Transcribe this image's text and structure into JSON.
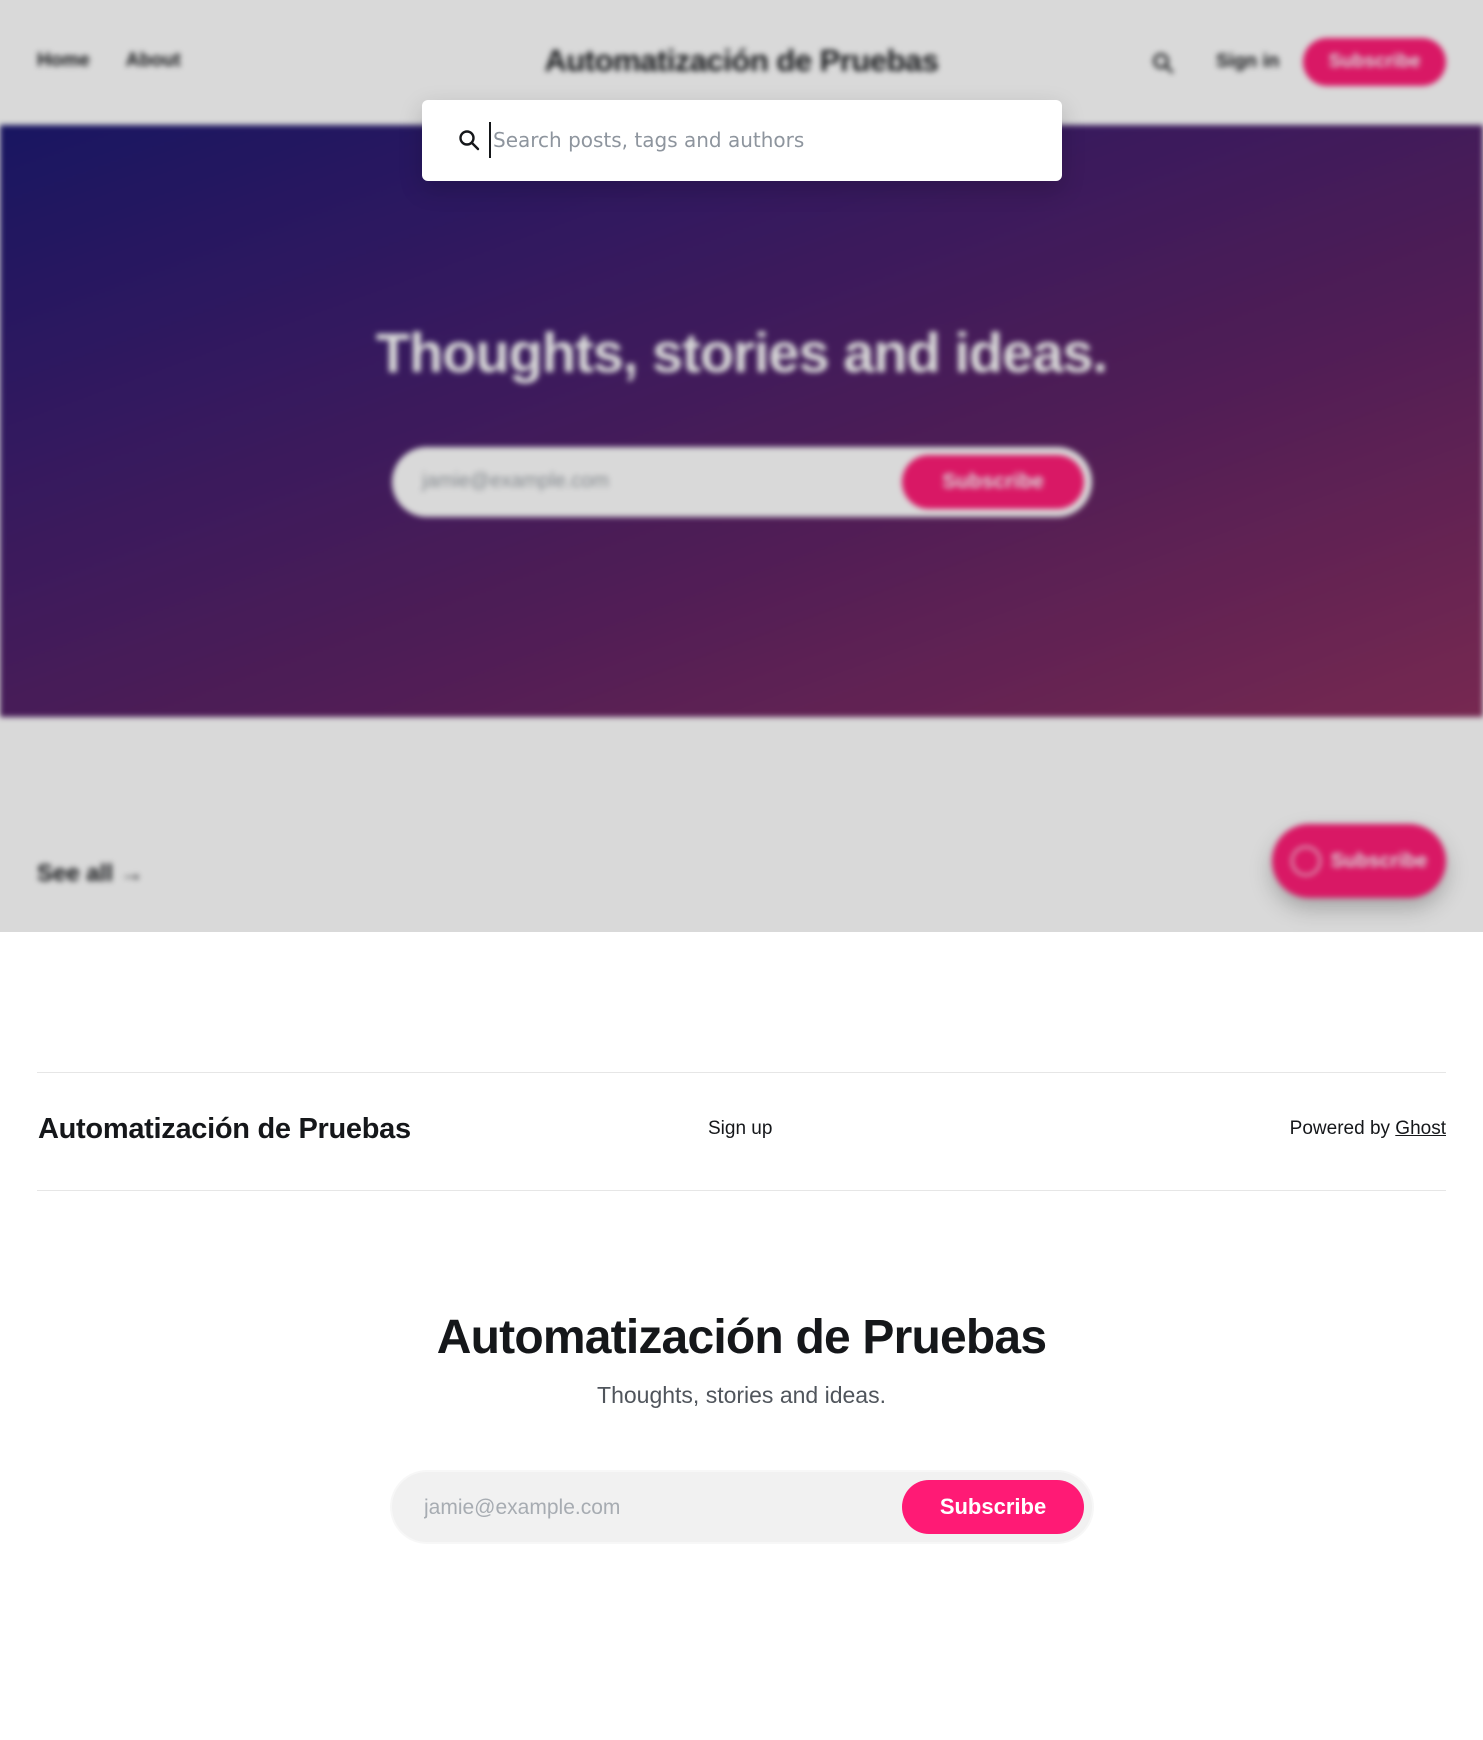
{
  "background_site": {
    "nav": [
      {
        "label": "Home"
      },
      {
        "label": "About"
      }
    ],
    "site_title": "Automatización de Pruebas",
    "signin_label": "Sign in",
    "subscribe_label": "Subscribe",
    "hero": {
      "title": "Thoughts, stories and ideas.",
      "email_placeholder": "jamie@example.com",
      "subscribe_label": "Subscribe"
    },
    "see_all_label": "See all →",
    "floating_subscribe_label": "Subscribe"
  },
  "search_modal": {
    "placeholder": "Search posts, tags and authors",
    "value": ""
  },
  "footer": {
    "brand": "Automatización de Pruebas",
    "signup_label": "Sign up",
    "powered_by_prefix": "Powered by",
    "powered_by_link": "Ghost"
  },
  "cta": {
    "title": "Automatización de Pruebas",
    "subtitle": "Thoughts, stories and ideas.",
    "email_placeholder": "jamie@example.com",
    "subscribe_label": "Subscribe"
  },
  "colors": {
    "accent": "#ff1a75",
    "text": "#15171a",
    "hero_gradient_start": "#1a1770",
    "hero_gradient_end": "#8a2d5d"
  },
  "icons": {
    "search": "search-icon",
    "floating_button": "user-circle-icon"
  }
}
